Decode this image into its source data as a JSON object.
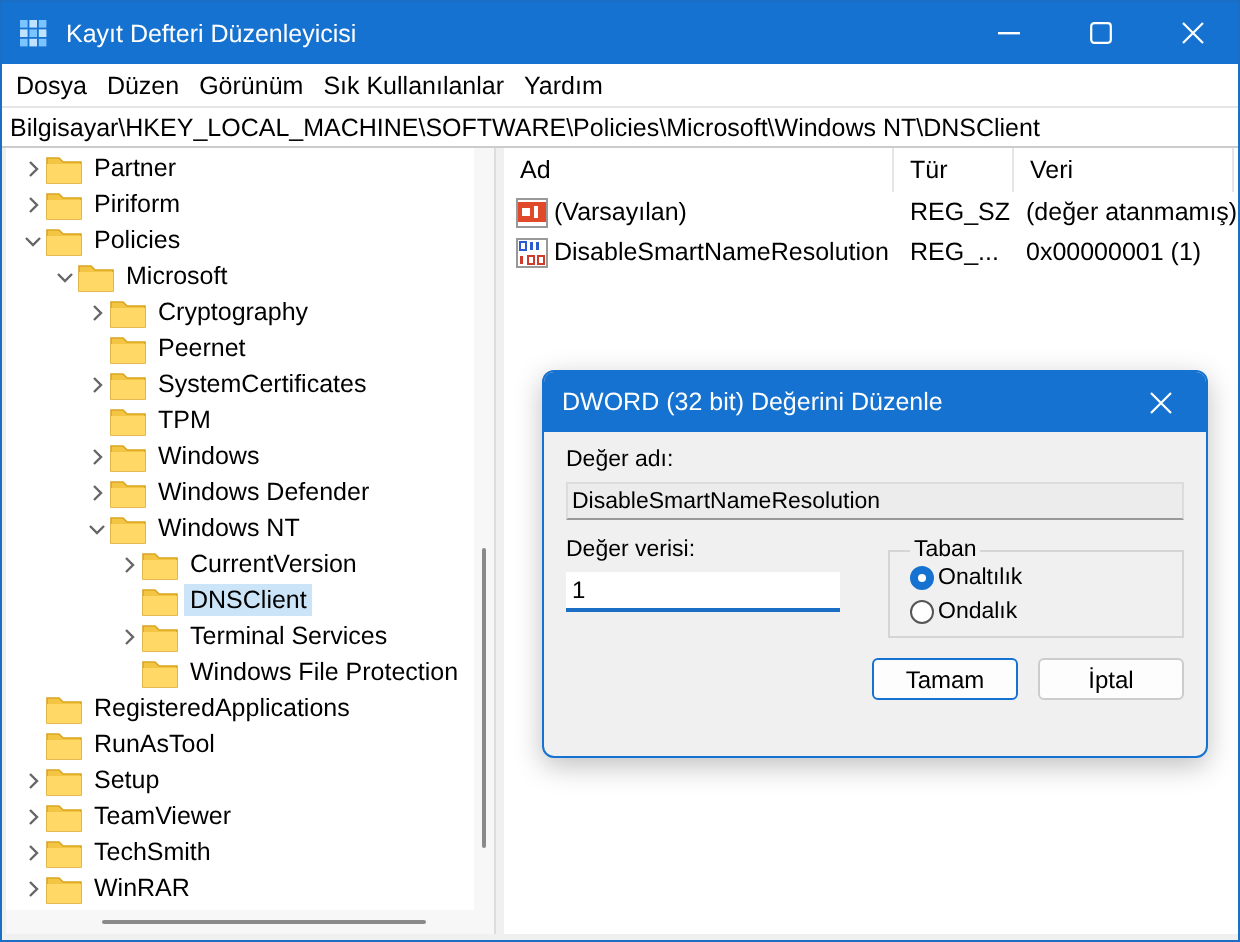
{
  "window": {
    "title": "Kayıt Defteri Düzenleyicisi"
  },
  "menu": [
    "Dosya",
    "Düzen",
    "Görünüm",
    "Sık Kullanılanlar",
    "Yardım"
  ],
  "address": "Bilgisayar\\HKEY_LOCAL_MACHINE\\SOFTWARE\\Policies\\Microsoft\\Windows NT\\DNSClient",
  "tree": [
    {
      "label": "Partner",
      "expandable": true,
      "expanded": false,
      "selected": false
    },
    {
      "label": "Piriform",
      "expandable": true,
      "expanded": false,
      "selected": false
    },
    {
      "label": "Policies",
      "expanded": true,
      "selected": false,
      "children": [
        {
          "label": "Microsoft",
          "expanded": true,
          "selected": false,
          "children": [
            {
              "label": "Cryptography",
              "expandable": true,
              "expanded": false,
              "selected": false
            },
            {
              "label": "Peernet",
              "expandable": false,
              "expanded": false,
              "selected": false
            },
            {
              "label": "SystemCertificates",
              "expandable": true,
              "expanded": false,
              "selected": false
            },
            {
              "label": "TPM",
              "expandable": false,
              "expanded": false,
              "selected": false
            },
            {
              "label": "Windows",
              "expandable": true,
              "expanded": false,
              "selected": false
            },
            {
              "label": "Windows Defender",
              "expandable": true,
              "expanded": false,
              "selected": false
            },
            {
              "label": "Windows NT",
              "expanded": true,
              "selected": false,
              "children": [
                {
                  "label": "CurrentVersion",
                  "expandable": true,
                  "expanded": false,
                  "selected": false
                },
                {
                  "label": "DNSClient",
                  "expandable": false,
                  "expanded": false,
                  "selected": true
                },
                {
                  "label": "Terminal Services",
                  "expandable": true,
                  "expanded": false,
                  "selected": false
                },
                {
                  "label": "Windows File Protection",
                  "expandable": false,
                  "expanded": false,
                  "selected": false
                }
              ]
            }
          ]
        }
      ]
    },
    {
      "label": "RegisteredApplications",
      "expandable": false,
      "expanded": false,
      "selected": false
    },
    {
      "label": "RunAsTool",
      "expandable": false,
      "expanded": false,
      "selected": false
    },
    {
      "label": "Setup",
      "expandable": true,
      "expanded": false,
      "selected": false
    },
    {
      "label": "TeamViewer",
      "expandable": true,
      "expanded": false,
      "selected": false
    },
    {
      "label": "TechSmith",
      "expandable": true,
      "expanded": false,
      "selected": false
    },
    {
      "label": "WinRAR",
      "expandable": true,
      "expanded": false,
      "selected": false
    }
  ],
  "table": {
    "columns": [
      "Ad",
      "Tür",
      "Veri"
    ],
    "rows": [
      {
        "kind": "string",
        "name": "(Varsayılan)",
        "type": "REG_SZ",
        "data": "(değer atanmamış)"
      },
      {
        "kind": "binary",
        "name": "DisableSmartNameResolution",
        "type": "REG_...",
        "data": "0x00000001 (1)"
      }
    ]
  },
  "dialog": {
    "title": "DWORD (32 bit) Değerini Düzenle",
    "name_label": "Değer adı:",
    "name_value": "DisableSmartNameResolution",
    "data_label": "Değer verisi:",
    "data_value": "1",
    "base_label": "Taban",
    "base_options": [
      {
        "label": "Onaltılık",
        "selected": true
      },
      {
        "label": "Ondalık",
        "selected": false
      }
    ],
    "buttons": [
      {
        "label": "Tamam",
        "default": true
      },
      {
        "label": "İptal",
        "default": false
      }
    ]
  }
}
